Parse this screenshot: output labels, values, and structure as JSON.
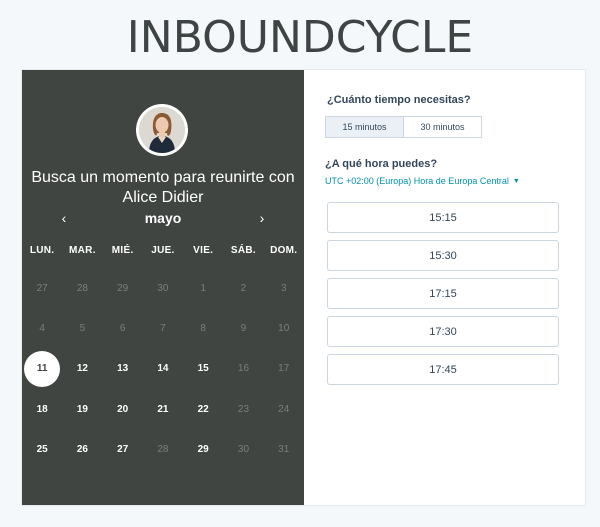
{
  "brand": {
    "logo_text": "INBOUNDCYCLE"
  },
  "host": {
    "heading": "Busca un momento para reunirte con Alice Didier",
    "avatar": "avatar-photo"
  },
  "calendar": {
    "month": "mayo",
    "prev_icon": "chevron-left-icon",
    "next_icon": "chevron-right-icon",
    "weekdays": [
      "LUN.",
      "MAR.",
      "MIÉ.",
      "JUE.",
      "VIE.",
      "SÁB.",
      "DOM."
    ],
    "selected_day": "11",
    "weeks": [
      [
        {
          "d": "27",
          "s": "muted"
        },
        {
          "d": "28",
          "s": "muted"
        },
        {
          "d": "29",
          "s": "muted"
        },
        {
          "d": "30",
          "s": "muted"
        },
        {
          "d": "1",
          "s": "muted"
        },
        {
          "d": "2",
          "s": "muted"
        },
        {
          "d": "3",
          "s": "muted"
        }
      ],
      [
        {
          "d": "4",
          "s": "muted"
        },
        {
          "d": "5",
          "s": "muted"
        },
        {
          "d": "6",
          "s": "muted"
        },
        {
          "d": "7",
          "s": "muted"
        },
        {
          "d": "8",
          "s": "muted"
        },
        {
          "d": "9",
          "s": "muted"
        },
        {
          "d": "10",
          "s": "muted"
        }
      ],
      [
        {
          "d": "11",
          "s": "selected"
        },
        {
          "d": "12",
          "s": "available"
        },
        {
          "d": "13",
          "s": "available"
        },
        {
          "d": "14",
          "s": "available"
        },
        {
          "d": "15",
          "s": "available"
        },
        {
          "d": "16",
          "s": "muted"
        },
        {
          "d": "17",
          "s": "muted"
        }
      ],
      [
        {
          "d": "18",
          "s": "available"
        },
        {
          "d": "19",
          "s": "available"
        },
        {
          "d": "20",
          "s": "available"
        },
        {
          "d": "21",
          "s": "available"
        },
        {
          "d": "22",
          "s": "available"
        },
        {
          "d": "23",
          "s": "muted"
        },
        {
          "d": "24",
          "s": "muted"
        }
      ],
      [
        {
          "d": "25",
          "s": "available"
        },
        {
          "d": "26",
          "s": "available"
        },
        {
          "d": "27",
          "s": "available"
        },
        {
          "d": "28",
          "s": "muted"
        },
        {
          "d": "29",
          "s": "available"
        },
        {
          "d": "30",
          "s": "muted"
        },
        {
          "d": "31",
          "s": "muted"
        }
      ]
    ]
  },
  "duration": {
    "question": "¿Cuánto tiempo necesitas?",
    "options": [
      "15 minutos",
      "30 minutos"
    ],
    "selected": "15 minutos"
  },
  "time": {
    "question": "¿A qué hora puedes?",
    "timezone": "UTC +02:00 (Europa) Hora de Europa Central",
    "timezone_icon": "caret-down-icon",
    "slots": [
      "15:15",
      "15:30",
      "17:15",
      "17:30",
      "17:45"
    ]
  },
  "colors": {
    "panel": "#404542",
    "link": "#0091ae",
    "text": "#33475b",
    "border": "#cbd6e2",
    "logo": "#3d4443"
  }
}
